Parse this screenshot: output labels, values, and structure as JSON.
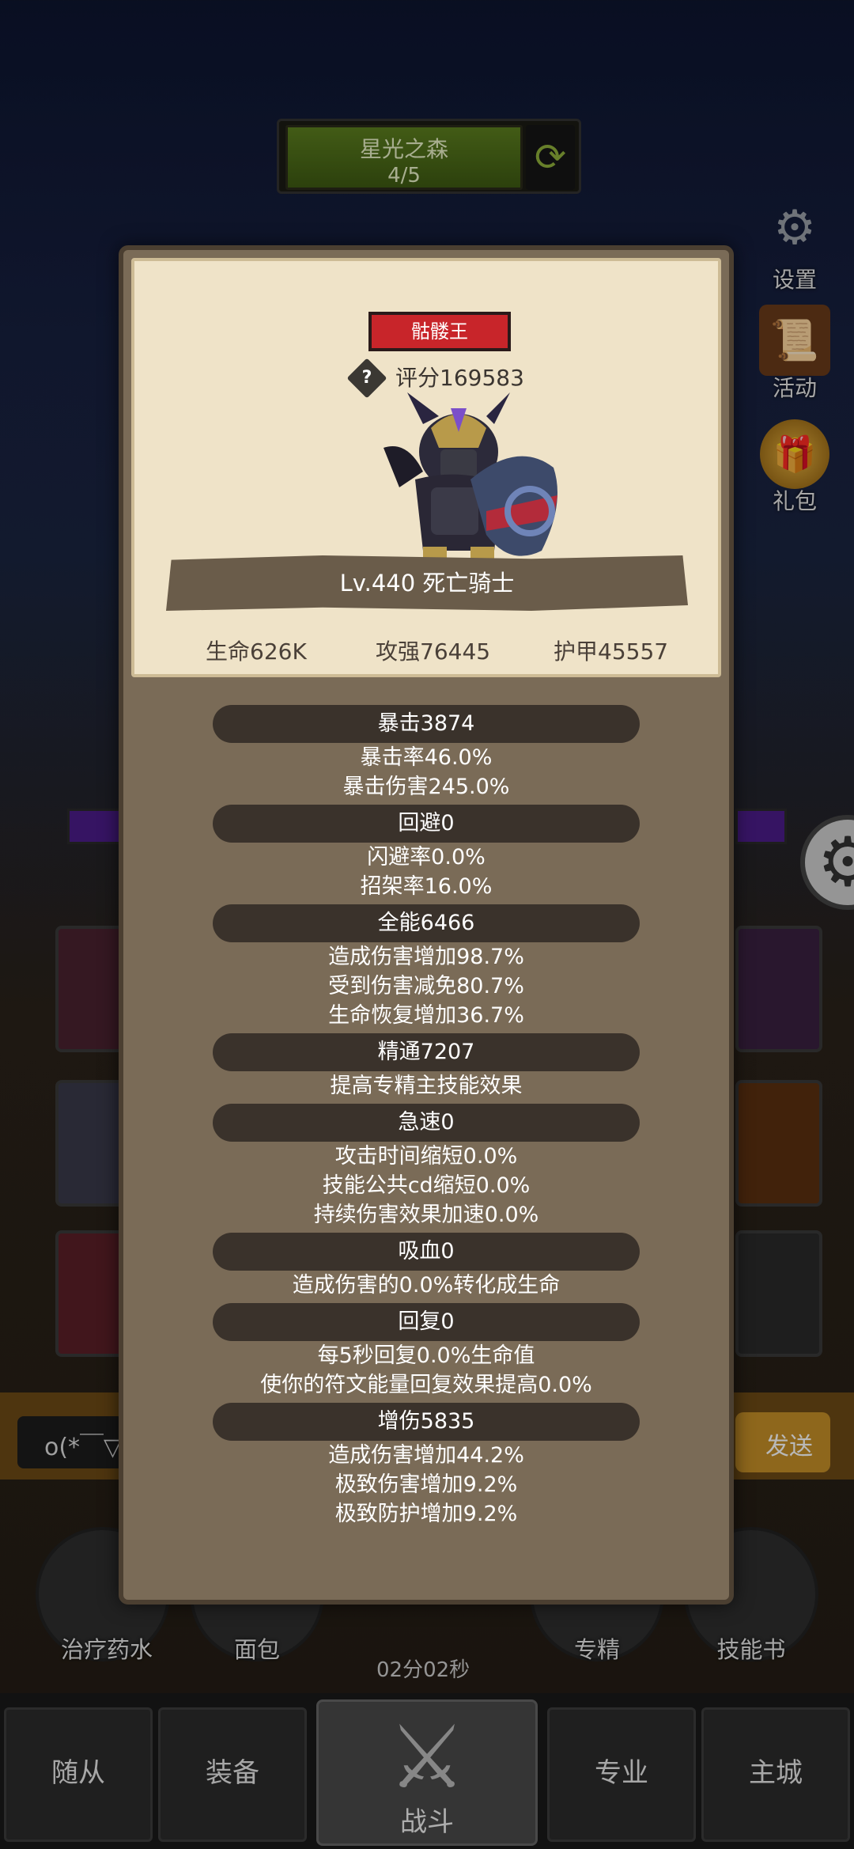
{
  "stage": {
    "name": "星光之森",
    "progress": "4/5",
    "refresh_icon": "refresh-icon"
  },
  "side_menu": [
    {
      "key": "settings",
      "label": "设置",
      "icon": "gear-icon"
    },
    {
      "key": "activity",
      "label": "活动",
      "icon": "scroll-icon"
    },
    {
      "key": "gift",
      "label": "礼包",
      "icon": "gift-icon"
    }
  ],
  "chat": {
    "input_value": "o(*￣▽",
    "send_label": "发送"
  },
  "consumables": [
    {
      "label": "治疗药水"
    },
    {
      "label": "面包"
    },
    {
      "label": "专精"
    },
    {
      "label": "技能书"
    }
  ],
  "timer": "02分02秒",
  "bottom_nav": {
    "followers": "随从",
    "equipment": "装备",
    "battle": "战斗",
    "profession": "专业",
    "main_city": "主城"
  },
  "popup": {
    "badge": "骷髅王",
    "score": "评分169583",
    "name_line": "Lv.440 死亡骑士",
    "stats": {
      "hp": "生命626K",
      "attack": "攻强76445",
      "armor": "护甲45557"
    },
    "sections": [
      {
        "title": "暴击3874",
        "lines": [
          "暴击率46.0%",
          "暴击伤害245.0%"
        ]
      },
      {
        "title": "回避0",
        "lines": [
          "闪避率0.0%",
          "招架率16.0%"
        ]
      },
      {
        "title": "全能6466",
        "lines": [
          "造成伤害增加98.7%",
          "受到伤害减免80.7%",
          "生命恢复增加36.7%"
        ]
      },
      {
        "title": "精通7207",
        "lines": [
          "提高专精主技能效果"
        ]
      },
      {
        "title": "急速0",
        "lines": [
          "攻击时间缩短0.0%",
          "技能公共cd缩短0.0%",
          "持续伤害效果加速0.0%"
        ]
      },
      {
        "title": "吸血0",
        "lines": [
          "造成伤害的0.0%转化成生命"
        ]
      },
      {
        "title": "回复0",
        "lines": [
          "每5秒回复0.0%生命值",
          "使你的符文能量回复效果提高0.0%"
        ]
      },
      {
        "title": "增伤5835",
        "lines": [
          "造成伤害增加44.2%",
          "极致伤害增加9.2%",
          "极致防护增加9.2%"
        ]
      }
    ]
  }
}
